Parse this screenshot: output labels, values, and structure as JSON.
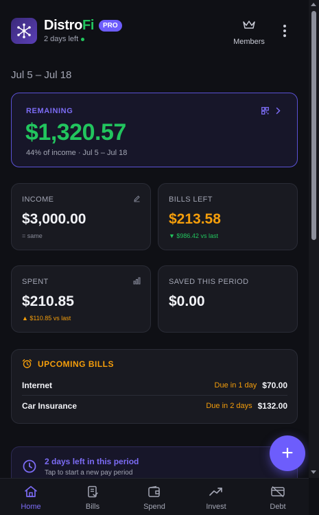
{
  "header": {
    "brand_main": "Distro",
    "brand_accent": "Fi",
    "badge": "PRO",
    "days_left": "2 days left",
    "members_label": "Members"
  },
  "period": "Jul 5 – Jul 18",
  "remaining": {
    "label": "REMAINING",
    "value": "$1,320.57",
    "subtitle": "44% of income · Jul 5 – Jul 18"
  },
  "cards": {
    "income": {
      "label": "INCOME",
      "value": "$3,000.00",
      "sub": "= same"
    },
    "bills_left": {
      "label": "BILLS LEFT",
      "value": "$213.58",
      "sub": "▼ $986.42 vs last"
    },
    "spent": {
      "label": "SPENT",
      "value": "$210.85",
      "sub": "▲ $110.85 vs last"
    },
    "saved": {
      "label": "SAVED THIS PERIOD",
      "value": "$0.00"
    }
  },
  "upcoming_bills": {
    "title": "UPCOMING BILLS",
    "items": [
      {
        "name": "Internet",
        "due": "Due in 1 day",
        "amount": "$70.00"
      },
      {
        "name": "Car Insurance",
        "due": "Due in 2 days",
        "amount": "$132.00"
      }
    ]
  },
  "notice": {
    "title": "2 days left in this period",
    "subtitle": "Tap to start a new pay period"
  },
  "fab_label": "+",
  "nav": [
    {
      "label": "Home",
      "icon": "home-icon",
      "active": true
    },
    {
      "label": "Bills",
      "icon": "bills-icon",
      "active": false
    },
    {
      "label": "Spend",
      "icon": "wallet-icon",
      "active": false
    },
    {
      "label": "Invest",
      "icon": "trending-up-icon",
      "active": false
    },
    {
      "label": "Debt",
      "icon": "credit-card-off-icon",
      "active": false
    }
  ],
  "colors": {
    "accent": "#6d5dfc",
    "green": "#22c55e",
    "orange": "#f59e0b",
    "background": "#0f1015"
  }
}
